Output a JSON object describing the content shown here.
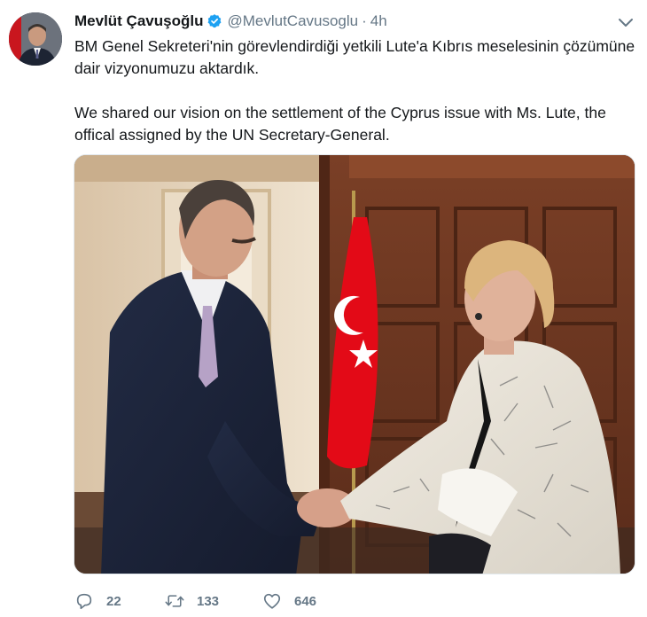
{
  "tweet": {
    "author_name": "Mevlüt Çavuşoğlu",
    "handle": "@MevlutCavusoglu",
    "separator": "·",
    "time": "4h",
    "text_tr": "BM Genel Sekreteri'nin görevlendirdiği yetkili Lute'a Kıbrıs meselesinin çözümüne dair vizyonumuzu aktardık.",
    "text_en": "We shared our vision on the settlement of the Cyprus issue with Ms. Lute, the offical assigned by the UN Secretary-General."
  },
  "actions": {
    "reply_count": "22",
    "retweet_count": "133",
    "like_count": "646"
  },
  "icons": {
    "verified": "verified-badge-icon",
    "caret": "chevron-down-icon",
    "reply": "reply-icon",
    "retweet": "retweet-icon",
    "like": "heart-icon"
  },
  "colors": {
    "verified": "#1da1f2",
    "secondary_text": "#657786",
    "flag": "#e30a17"
  }
}
